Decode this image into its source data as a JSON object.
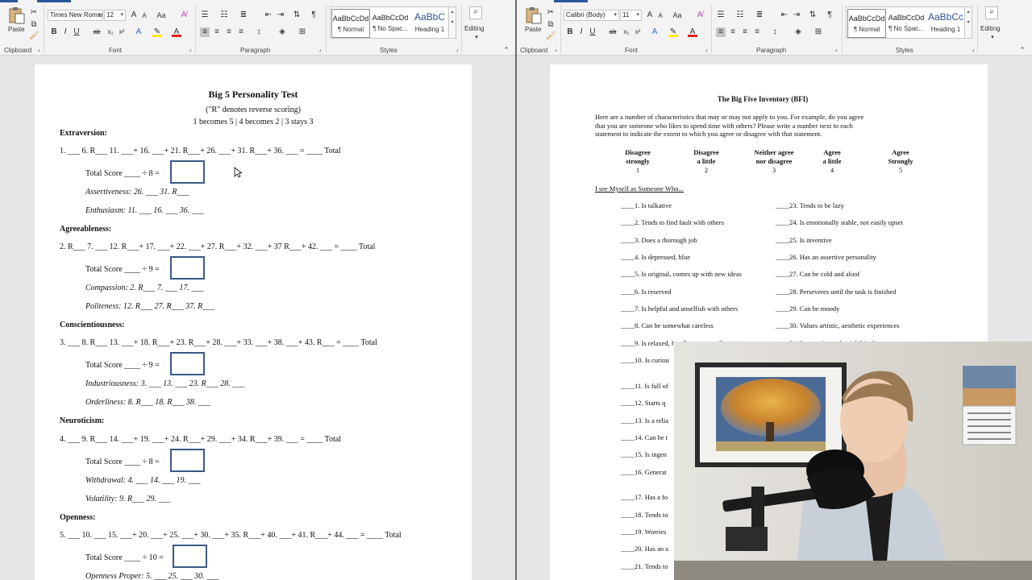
{
  "ribbon": {
    "paste": "Paste",
    "clipboard": "Clipboard",
    "font_group": "Font",
    "paragraph_group": "Paragraph",
    "styles_group": "Styles",
    "editing": "Editing",
    "bold": "B",
    "italic": "I",
    "underline": "U",
    "strike": "ab",
    "sub": "x₂",
    "sup": "x²",
    "grow": "A",
    "shrink": "A",
    "case": "Aa",
    "pilcrow": "¶"
  },
  "left_ribbon": {
    "font_name": "Times New Roman",
    "font_size": "12",
    "styles": [
      {
        "preview": "AaBbCcDd",
        "name": "¶ Normal"
      },
      {
        "preview": "AaBbCcDd",
        "name": "¶ No Spac..."
      },
      {
        "preview": "AaBbC",
        "name": "Heading 1"
      }
    ]
  },
  "right_ribbon": {
    "font_name": "Calibri (Body)",
    "font_size": "11",
    "styles": [
      {
        "preview": "AaBbCcDd",
        "name": "¶ Normal"
      },
      {
        "preview": "AaBbCcDd",
        "name": "¶ No Spac..."
      },
      {
        "preview": "AaBbCc",
        "name": "Heading 1"
      }
    ]
  },
  "left_doc": {
    "title": "Big 5 Personality Test",
    "subtitle": "(\"R\" denotes reverse scoring)",
    "subtitle2": "1 becomes 5 | 4 becomes 2 | 3 stays 3",
    "sections": [
      {
        "heading": "Extraversion:",
        "formula": "1. ___ 6. R___ 11. ___+ 16. ___+ 21. R___+ 26. ___+ 31. R___+ 36. ___ = ____ Total",
        "total": "Total Score ____ ÷ 8 =",
        "subs": [
          "Assertiveness: 26. ___ 31. R___",
          "Enthusiasm: 11. ___ 16. ___ 36. ___"
        ]
      },
      {
        "heading": "Agreeableness:",
        "formula": "2. R___ 7. ___ 12. R___+ 17. ___+ 22. ___+ 27. R___+ 32. ___+ 37 R___+ 42. ___ = ____ Total",
        "total": "Total Score ____ ÷ 9 =",
        "subs": [
          "Compassion: 2. R___ 7. ___ 17. ___",
          "Politeness: 12. R___ 27. R___ 37. R___"
        ]
      },
      {
        "heading": "Conscientiousness:",
        "formula": "3. ___ 8. R___ 13. ___+ 18. R___+ 23. R___+ 28. ___+ 33. ___+ 38. ___+ 43. R___ = ____ Total",
        "total": "Total Score ____ ÷ 9 =",
        "subs": [
          "Industriousness: 3. ___ 13. ___ 23. R___ 28. ___",
          "Orderliness: 8. R___ 18. R___ 38. ___"
        ]
      },
      {
        "heading": "Neuroticism:",
        "formula": "4. ___ 9. R___ 14. ___+ 19. ___+ 24. R___+ 29. ___+ 34. R___+ 39. ___ = ____ Total",
        "total": "Total Score ____ ÷ 8 =",
        "subs": [
          "Withdrawal: 4. ___ 14. ___ 19. ___",
          "Volatility: 9. R___ 29. ___"
        ]
      },
      {
        "heading": "Openness:",
        "formula": "5. ___ 10. ___ 15. ___+ 20. ___+ 25. ___+ 30. ___+ 35. R___+ 40. ___+ 41. R___+ 44. ___ = ____ Total",
        "total": "Total Score ____ ÷ 10 =",
        "subs": [
          "Openness Proper: 5. ___ 25. ___ 30. ___"
        ]
      }
    ]
  },
  "right_doc": {
    "title": "The Big Five Inventory (BFI)",
    "intro": [
      "Here are a number of characteristics that may or may not apply to you. For example, do you agree",
      "that you are someone who likes to spend time with others? Please write a number next to each",
      "statement to indicate the extent to which you agree or disagree with that statement."
    ],
    "scale": [
      {
        "l1": "Disagree",
        "l2": "strongly",
        "n": "1"
      },
      {
        "l1": "Disagree",
        "l2": "a little",
        "n": "2"
      },
      {
        "l1": "Neither agree",
        "l2": "nor disagree",
        "n": "3"
      },
      {
        "l1": "Agree",
        "l2": "a little",
        "n": "4"
      },
      {
        "l1": "Agree",
        "l2": "Strongly",
        "n": "5"
      }
    ],
    "lead": "I see Myself as Someone Who...",
    "col1": [
      "____1. Is talkative",
      "____2. Tends to find fault with others",
      "____3. Does a thorough job",
      "____4. Is depressed, blue",
      "____5. Is original, comes up with new ideas",
      "____6. Is reserved",
      "____7. Is helpful and unselfish with others",
      "____8. Can be somewhat careless",
      "____9. Is relaxed, handles stress well",
      "____10. Is curiou",
      "____11. Is full of",
      "____12. Starts q",
      "____13. Is a relia",
      "____14. Can be t",
      "____15. Is ingen",
      "____16. Generat",
      "____17. Has a fo",
      "____18. Tends to",
      "____19. Worries",
      "____20. Has an a",
      "____21. Tends to",
      "____22. Is gener"
    ],
    "col2": [
      "____23. Tends to be lazy",
      "____24. Is emotionally stable, not easily upset",
      "____25. Is inventive",
      "____26. Has an assertive personality",
      "____27. Can be cold and aloof",
      "____28. Perseveres until the task is finished",
      "____29. Can be moody",
      "____30. Values artistic, aesthetic experiences",
      "____31. Is sometimes shy, inhibited"
    ]
  },
  "colors": {
    "accent": "#2b579a",
    "score_box": "#3a5a84"
  }
}
